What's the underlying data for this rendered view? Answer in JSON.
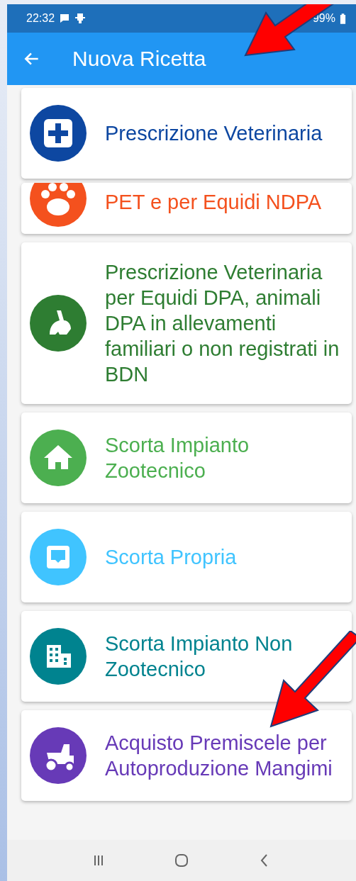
{
  "status_bar": {
    "time": "22:32",
    "battery": "99%"
  },
  "app_bar": {
    "title": "Nuova Ricetta"
  },
  "items": [
    {
      "label": "Prescrizione Veterinaria",
      "color": "#0d47a1",
      "kind": "full"
    },
    {
      "label": "PET e per Equidi NDPA",
      "color": "#f4511e",
      "kind": "clipped"
    },
    {
      "label": "Prescrizione Veterinaria per Equidi DPA, animali DPA in allevamenti familiari o non registrati in BDN",
      "color": "#2e7d32",
      "kind": "full"
    },
    {
      "label": "Scorta Impianto Zootecnico",
      "color": "#4caf50",
      "kind": "full"
    },
    {
      "label": "Scorta Propria",
      "color": "#40c4ff",
      "kind": "full"
    },
    {
      "label": "Scorta Impianto Non Zootecnico",
      "color": "#00838f",
      "kind": "full"
    },
    {
      "label": "Acquisto Premiscele per Autoproduzione Mangimi",
      "color": "#673ab7",
      "kind": "full"
    }
  ]
}
